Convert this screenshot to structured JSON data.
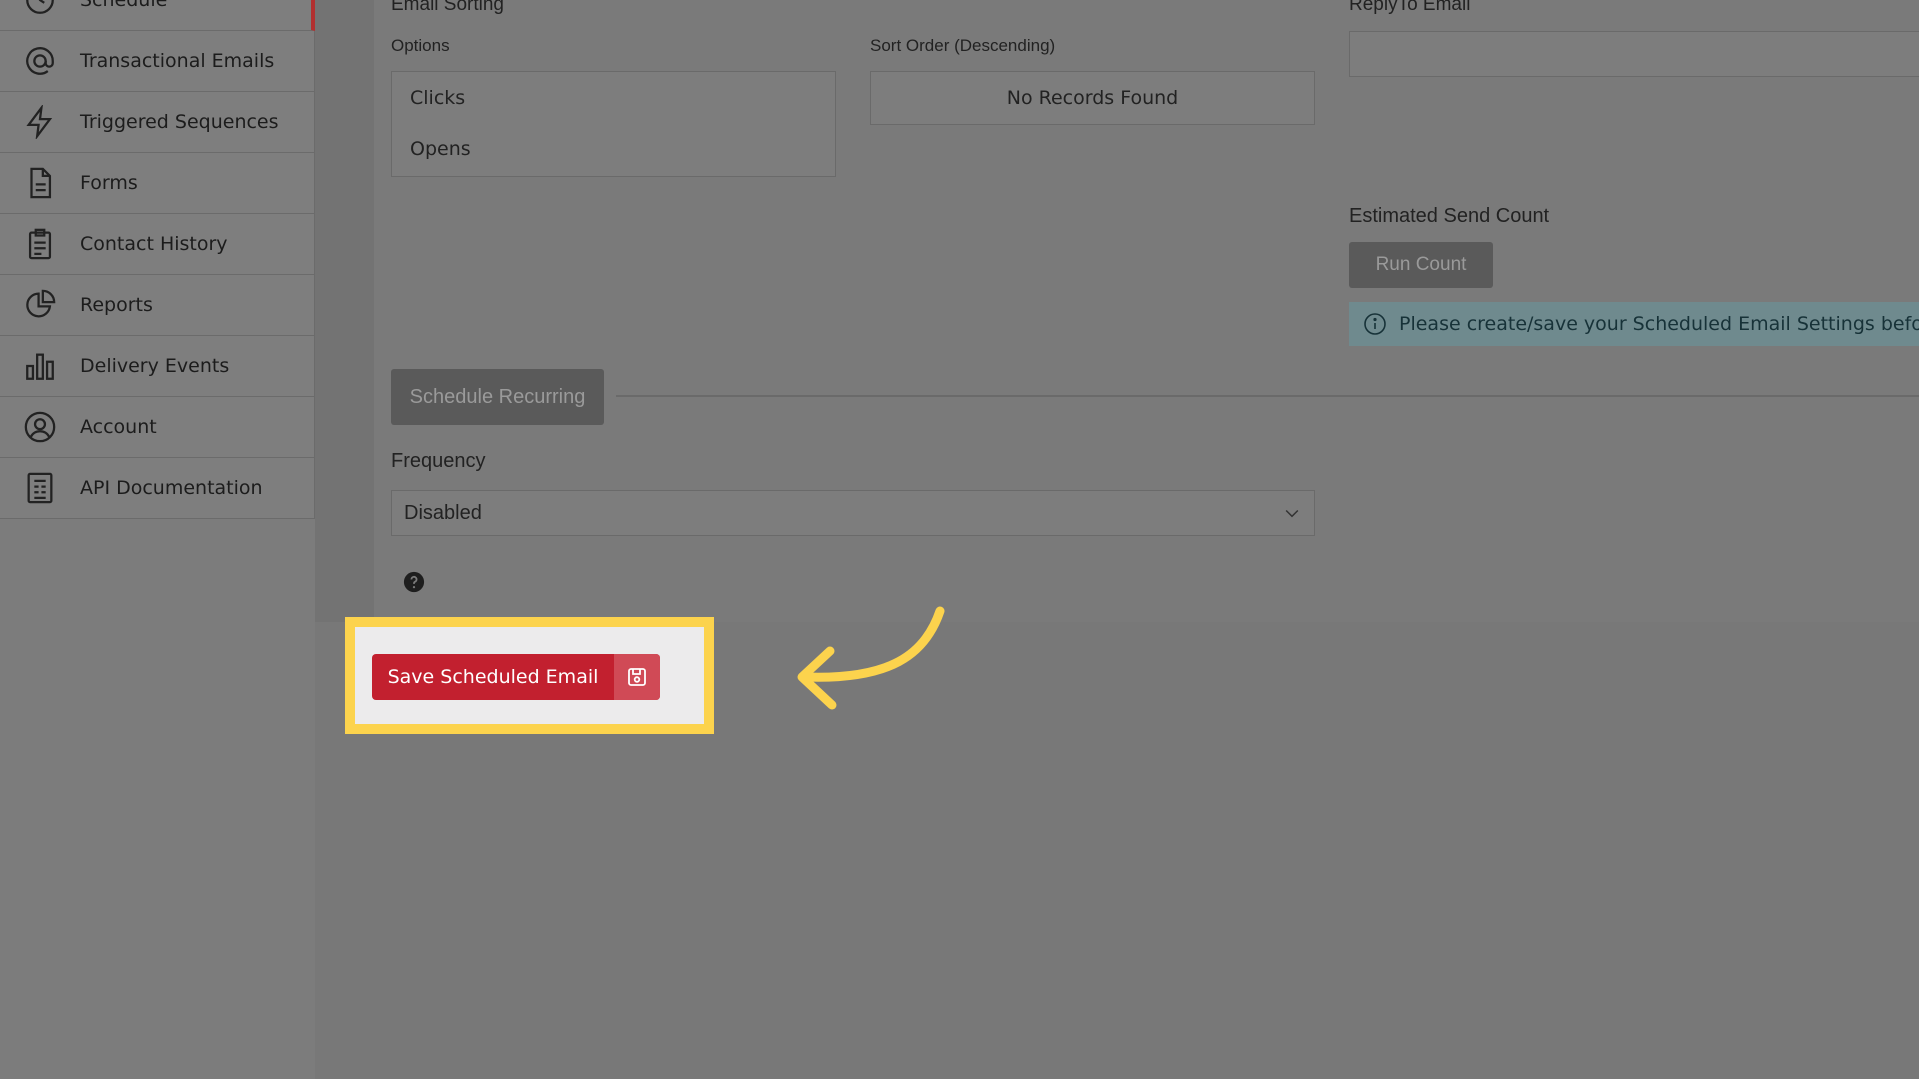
{
  "sidebar": {
    "items": [
      {
        "label": "Schedule",
        "icon": "clock-icon"
      },
      {
        "label": "Transactional Emails",
        "icon": "at-sign-icon"
      },
      {
        "label": "Triggered Sequences",
        "icon": "lightning-icon"
      },
      {
        "label": "Forms",
        "icon": "document-icon"
      },
      {
        "label": "Contact History",
        "icon": "clipboard-icon"
      },
      {
        "label": "Reports",
        "icon": "pie-chart-icon"
      },
      {
        "label": "Delivery Events",
        "icon": "bar-chart-icon"
      },
      {
        "label": "Account",
        "icon": "user-circle-icon"
      },
      {
        "label": "API Documentation",
        "icon": "api-doc-icon"
      }
    ]
  },
  "email_sorting": {
    "heading": "Email Sorting",
    "options_label": "Options",
    "options": [
      "Clicks",
      "Opens"
    ],
    "sort_order_label": "Sort Order (Descending)",
    "sort_empty": "No Records Found"
  },
  "reply_to": {
    "label": "ReplyTo Email",
    "value": ""
  },
  "send_count": {
    "label": "Estimated Send Count",
    "button": "Run Count",
    "info": "Please create/save your Scheduled Email Settings before te"
  },
  "recurring": {
    "button": "Schedule Recurring",
    "frequency_label": "Frequency",
    "frequency_value": "Disabled"
  },
  "actions": {
    "save_label": "Save Scheduled Email"
  },
  "colors": {
    "accent": "#c2202f",
    "highlight": "#fcd34d"
  }
}
